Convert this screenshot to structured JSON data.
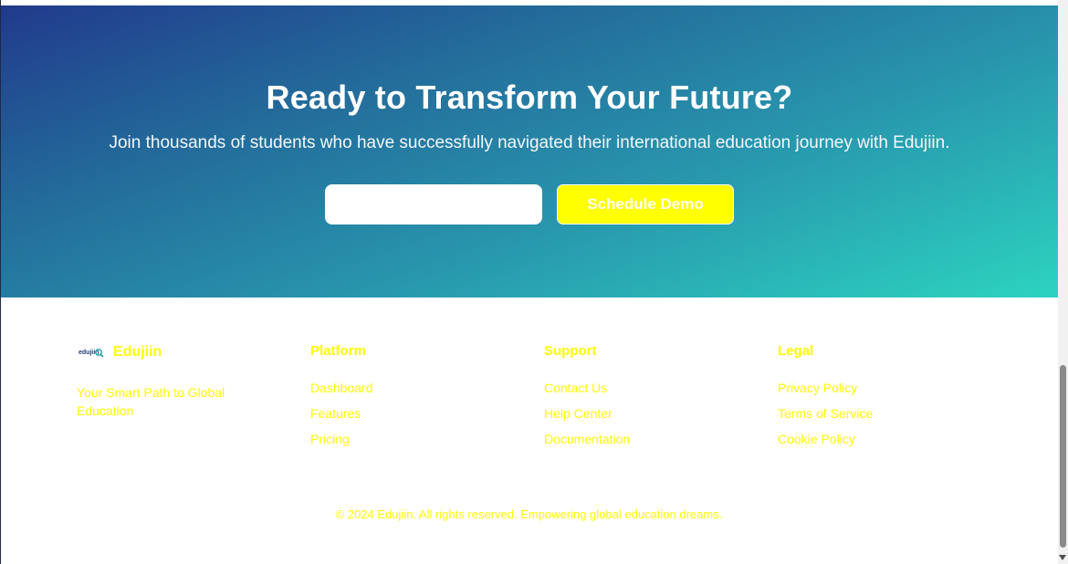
{
  "cta": {
    "title": "Ready to Transform Your Future?",
    "subtitle": "Join thousands of students who have successfully navigated their international education journey with Edujiin.",
    "email_value": "",
    "button_label": "Schedule Demo"
  },
  "footer": {
    "brand": {
      "name": "Edujiin",
      "logo_text": "edujiin",
      "tagline": "Your Smart Path to Global Education"
    },
    "columns": [
      {
        "title": "Platform",
        "links": [
          "Dashboard",
          "Features",
          "Pricing"
        ]
      },
      {
        "title": "Support",
        "links": [
          "Contact Us",
          "Help Center",
          "Documentation"
        ]
      },
      {
        "title": "Legal",
        "links": [
          "Privacy Policy",
          "Terms of Service",
          "Cookie Policy"
        ]
      }
    ],
    "copyright": "© 2024 Edujiin. All rights reserved. Empowering global education dreams."
  },
  "colors": {
    "accent_yellow": "#ffff00",
    "gradient_start": "#213a8c",
    "gradient_end": "#2cd3c0"
  },
  "icons": {
    "logo": "edujiin-logo-icon",
    "scroll_down": "chevron-down-icon"
  }
}
